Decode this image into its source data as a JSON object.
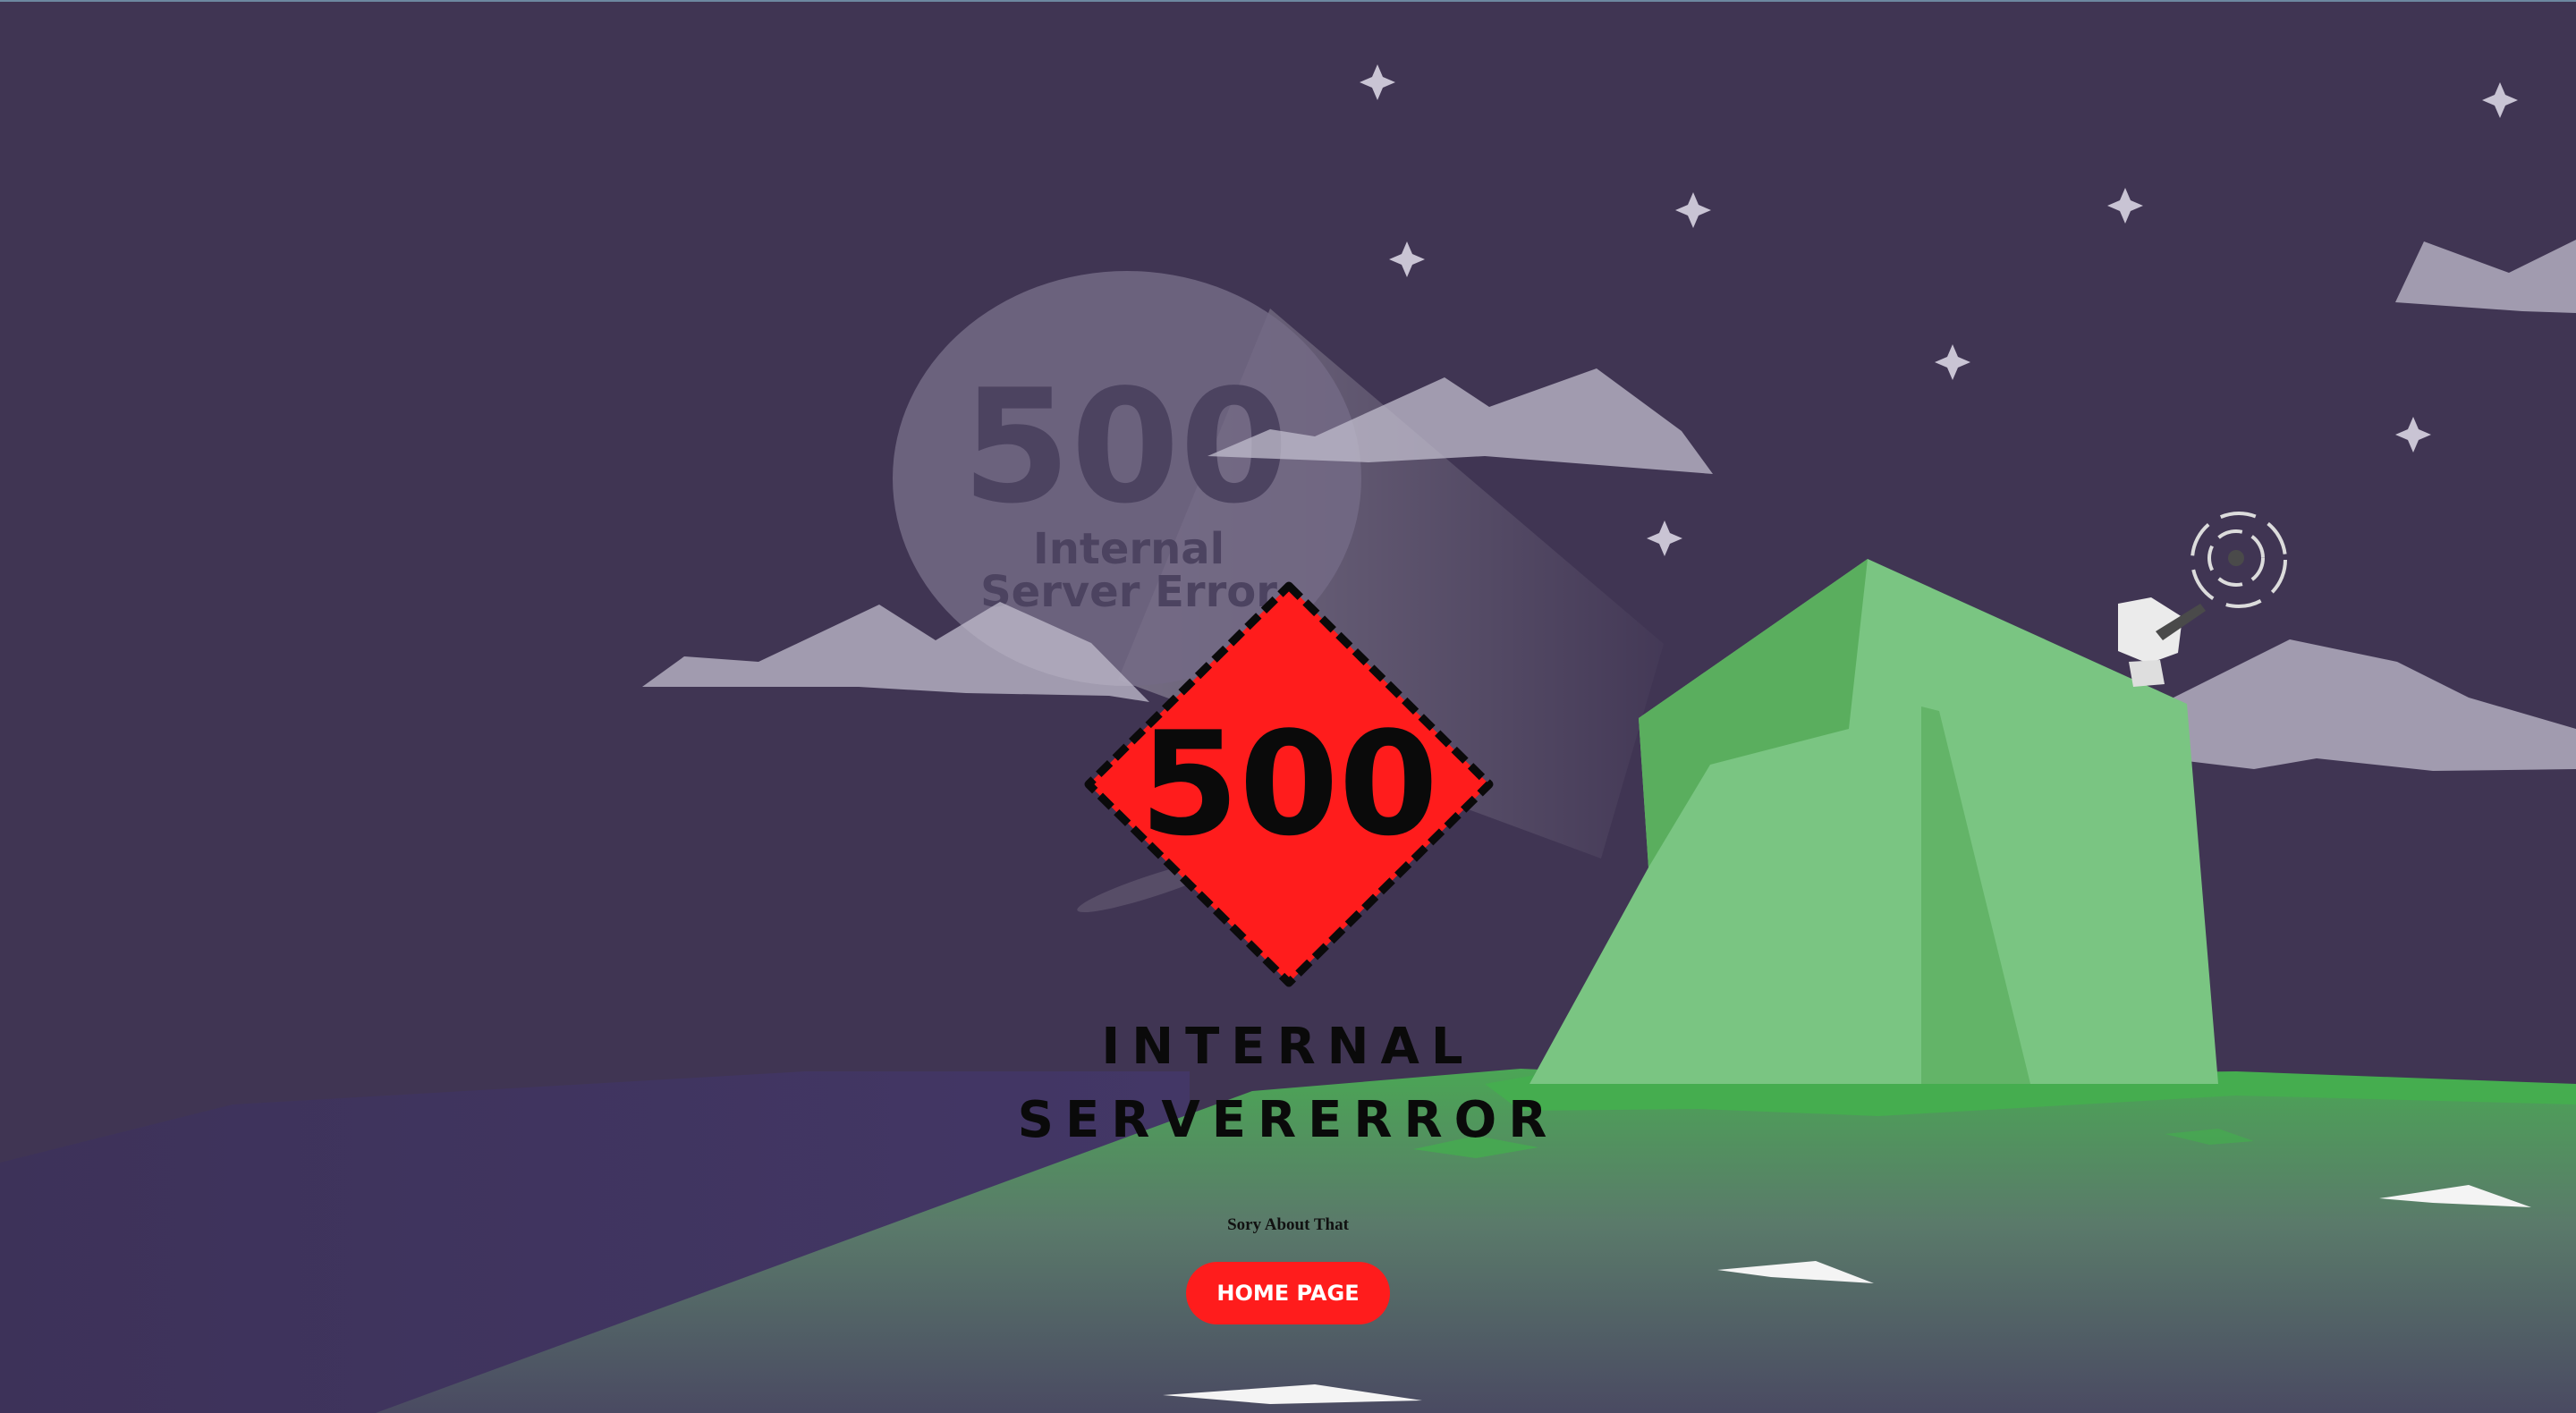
{
  "error": {
    "code": "500",
    "moon_code": "500",
    "moon_line1": "Internal",
    "moon_line2": "Server Error",
    "title_line1": "INTERNAL",
    "title_line2": "SERVERERROR",
    "subtitle": "Sory About That",
    "button_label": "HOME PAGE"
  },
  "colors": {
    "sky": "#403553",
    "mountain": "#7ac582",
    "ground_green": "#45ad4f",
    "sign_red": "#ff1c1c",
    "button_red": "#ff1c1c",
    "clouds": "#a9a3b8"
  },
  "icons": {
    "stars": "star-icon",
    "satellite": "satellite-dish-icon",
    "sign": "warning-diamond-icon"
  }
}
